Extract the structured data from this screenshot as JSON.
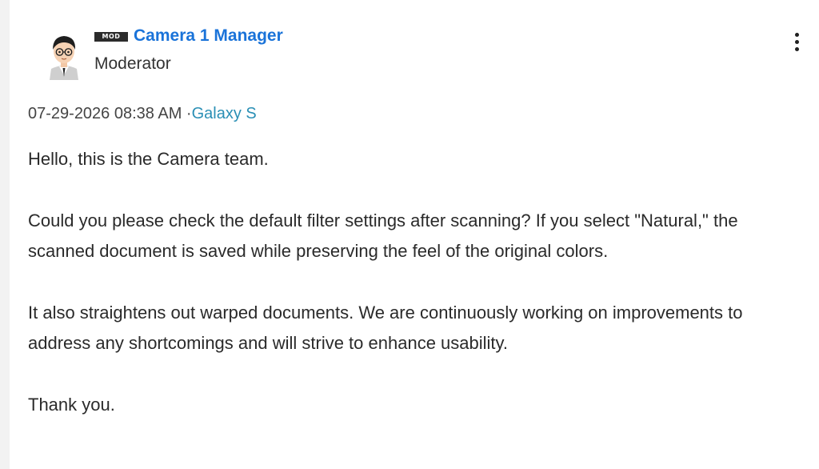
{
  "author": {
    "badge": "MOD",
    "name": "Camera 1 Manager",
    "role": "Moderator"
  },
  "meta": {
    "timestamp": "07-29-2026 08:38 AM",
    "separator": " ·",
    "device": "Galaxy S"
  },
  "message": {
    "paragraphs": [
      "Hello, this is the Camera team.",
      "Could you please check the default filter settings after scanning? If you select \"Natural,\" the scanned document is saved while preserving the feel of the original colors.",
      "It also straightens out warped documents. We are continuously working on improvements to address any shortcomings and will strive to enhance usability.",
      "Thank you."
    ]
  },
  "icons": {
    "menu": "kebab-menu-icon",
    "avatar": "user-avatar"
  },
  "colors": {
    "author_link": "#1a73d9",
    "device_link": "#2a8fb5",
    "badge_bg": "#2b2b2b"
  }
}
